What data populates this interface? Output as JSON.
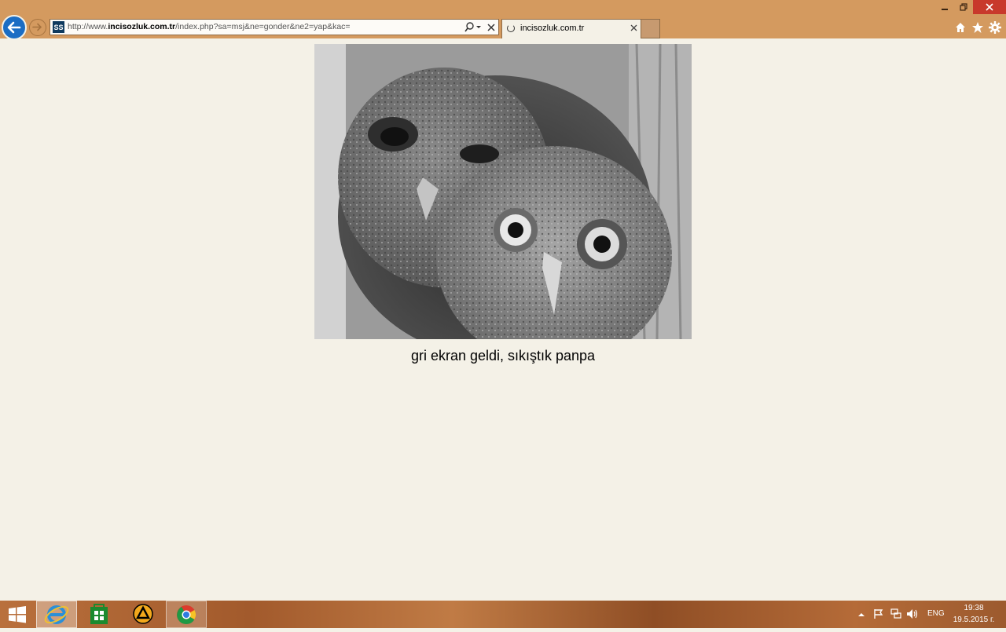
{
  "window": {
    "minimize_icon": "minimize-icon",
    "restore_icon": "restore-icon",
    "close_icon": "close-icon"
  },
  "browser": {
    "address_bar": {
      "url_prefix": "http://www.",
      "url_domain": "incisozluk.com.tr",
      "url_path": "/index.php?sa=msj&ne=gonder&ne2=yap&kac=",
      "favicon_text": "SS"
    },
    "tab": {
      "title": "incisozluk.com.tr",
      "loading": true
    },
    "accent_color": "#1b6dc4",
    "frame_color": "#d49a5f"
  },
  "page": {
    "image_alt": "owl-photo",
    "caption": "gri ekran geldi, sıkıştık panpa",
    "background_color": "#f4f1e7"
  },
  "taskbar": {
    "apps": [
      "start",
      "internet-explorer",
      "windows-store",
      "app",
      "chrome"
    ],
    "tray": {
      "language": "ENG",
      "time": "19:38",
      "date": "19.5.2015 г."
    }
  }
}
